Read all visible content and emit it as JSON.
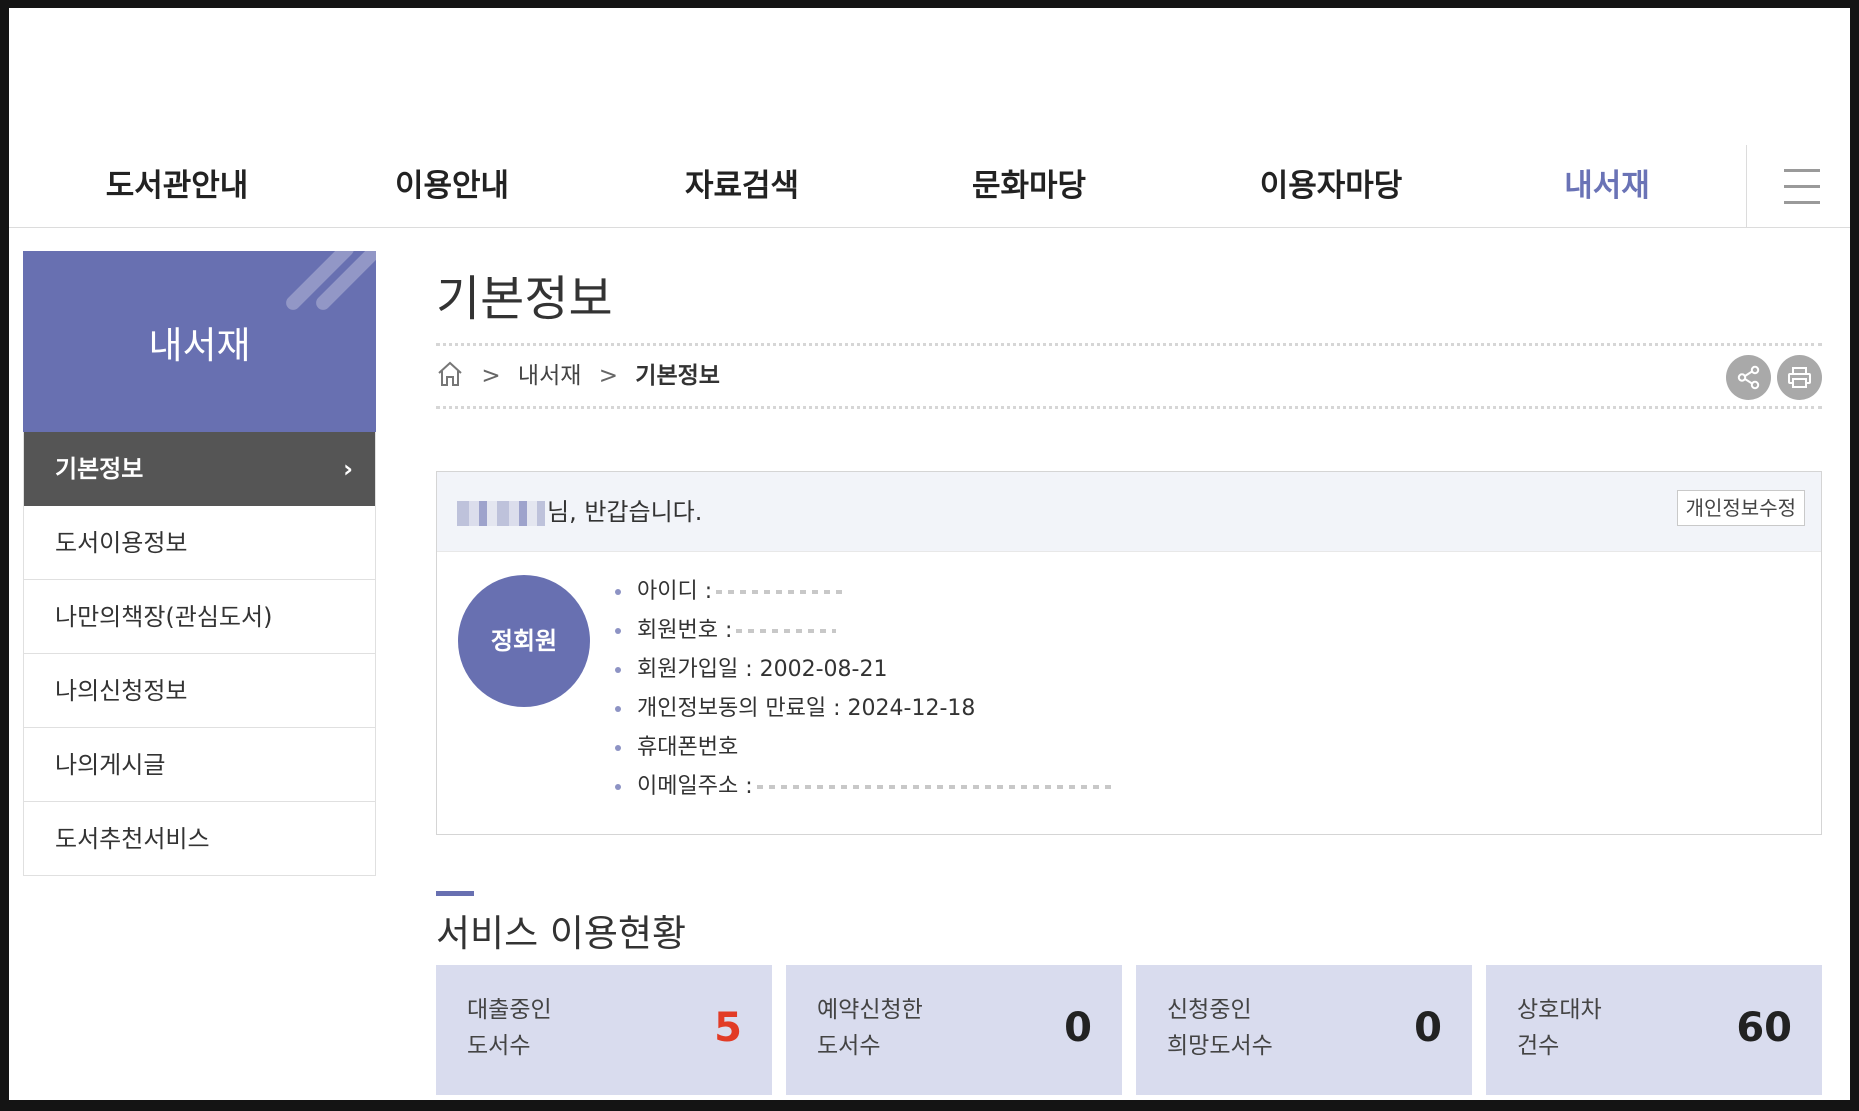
{
  "nav": {
    "items": [
      "도서관안내",
      "이용안내",
      "자료검색",
      "문화마당",
      "이용자마당",
      "내서재"
    ],
    "active_index": 5,
    "menu_icon": "hamburger-icon"
  },
  "sidebar": {
    "title": "내서재",
    "items": [
      {
        "label": "기본정보",
        "active": true
      },
      {
        "label": "도서이용정보"
      },
      {
        "label": "나만의책장(관심도서)"
      },
      {
        "label": "나의신청정보"
      },
      {
        "label": "나의게시글"
      },
      {
        "label": "도서추천서비스"
      }
    ],
    "chevron": "›"
  },
  "page": {
    "title": "기본정보",
    "breadcrumb": {
      "sep": ">",
      "section": "내서재",
      "current": "기본정보"
    },
    "share_icon": "share-icon",
    "print_icon": "print-icon"
  },
  "profile": {
    "greeting": "님, 반갑습니다.",
    "edit_label": "개인정보수정",
    "badge": "정회원",
    "fields": [
      {
        "label": "아이디 :",
        "value": ""
      },
      {
        "label": "회원번호 :",
        "value": ""
      },
      {
        "label": "회원가입일 : 2002-08-21",
        "value": ""
      },
      {
        "label": "개인정보동의 만료일 : 2024-12-18",
        "value": ""
      },
      {
        "label": "휴대폰번호",
        "value": ""
      },
      {
        "label": "이메일주소 :",
        "value": ""
      }
    ]
  },
  "service": {
    "title": "서비스 이용현황",
    "cards": [
      {
        "line1": "대출중인",
        "line2": "도서수",
        "count": "5",
        "highlight": true
      },
      {
        "line1": "예약신청한",
        "line2": "도서수",
        "count": "0"
      },
      {
        "line1": "신청중인",
        "line2": "희망도서수",
        "count": "0"
      },
      {
        "line1": "상호대차",
        "line2": "건수",
        "count": "60"
      }
    ]
  },
  "colors": {
    "accent": "#6870b1",
    "card_bg": "#d9dcee",
    "highlight": "#e23b26"
  }
}
